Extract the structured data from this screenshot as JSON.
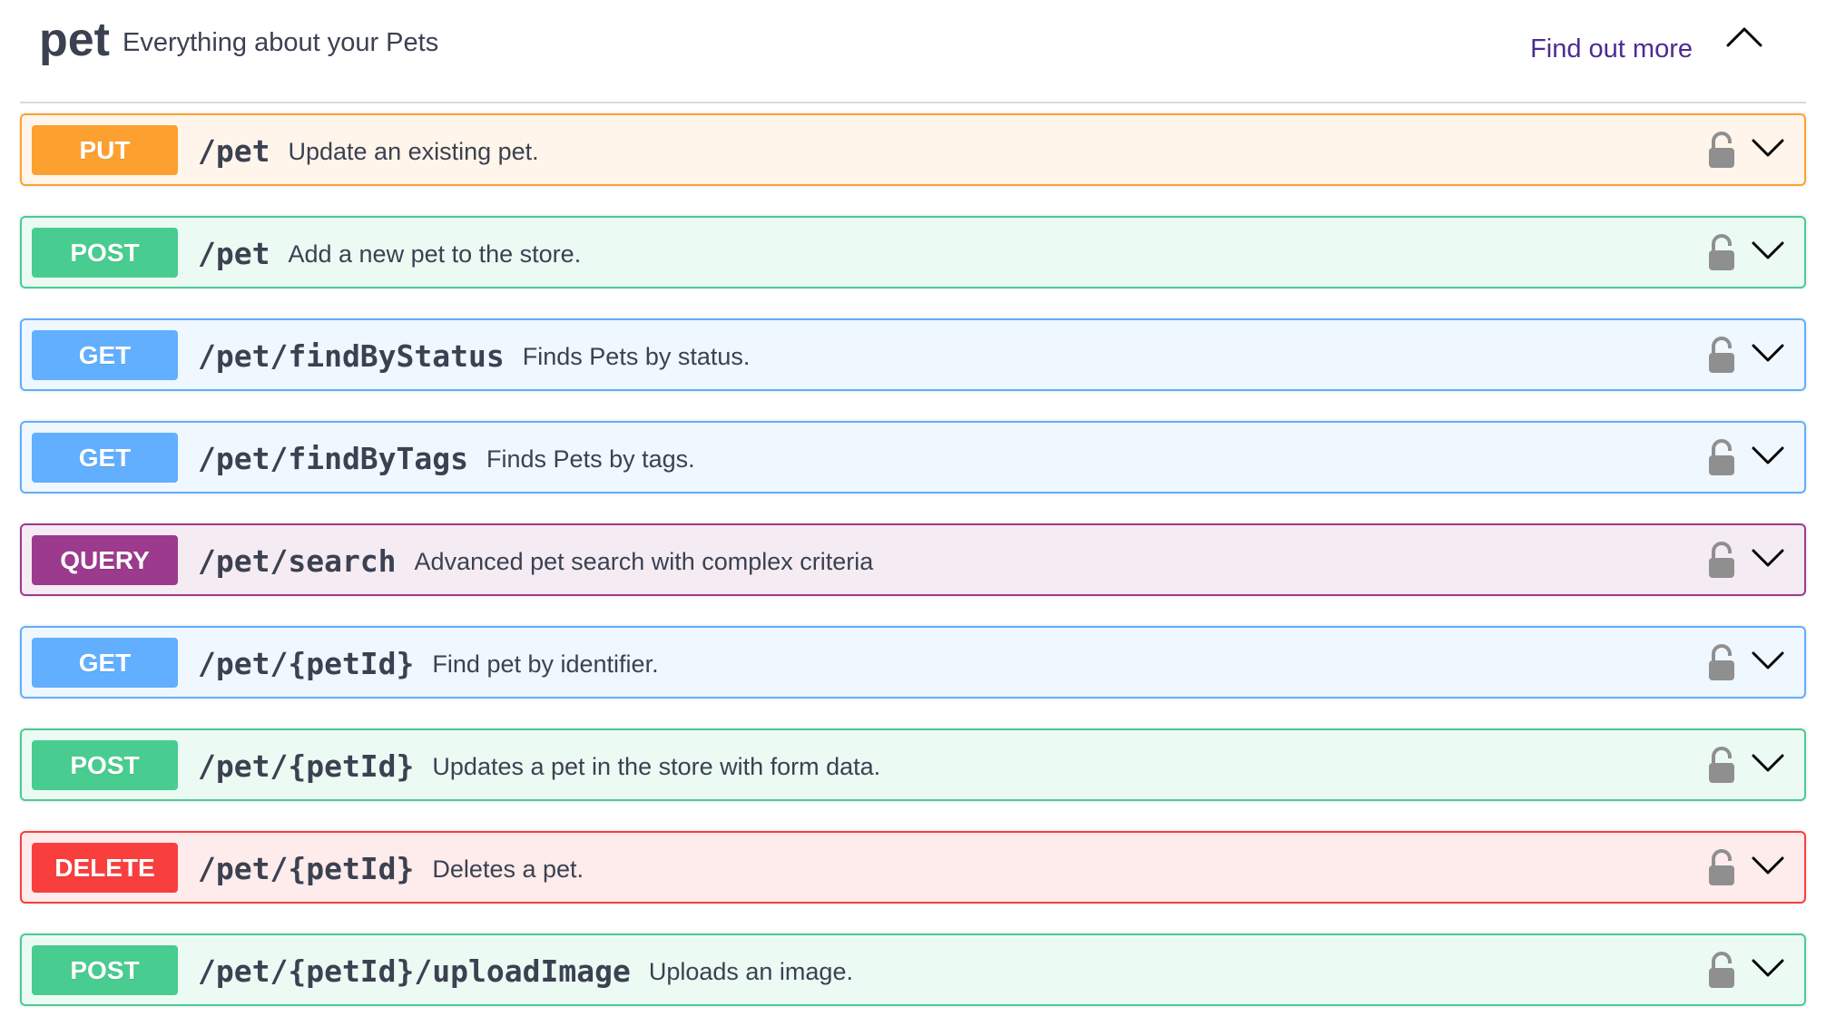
{
  "tag": {
    "name": "pet",
    "description": "Everything about your Pets",
    "link_label": "Find out more",
    "toggle_icon": "chevron-up-icon"
  },
  "colors": {
    "put": "#fca130",
    "post": "#49cc90",
    "get": "#61affe",
    "delete": "#f93e3e",
    "query": "#9c3a8e",
    "link": "#4c2c92",
    "text": "#3b4151"
  },
  "operations": [
    {
      "method": "PUT",
      "path": "/pet",
      "summary": "Update an existing pet.",
      "lock_icon": "lock-icon",
      "expand_icon": "chevron-down-icon"
    },
    {
      "method": "POST",
      "path": "/pet",
      "summary": "Add a new pet to the store.",
      "lock_icon": "lock-icon",
      "expand_icon": "chevron-down-icon"
    },
    {
      "method": "GET",
      "path": "/pet/findByStatus",
      "summary": "Finds Pets by status.",
      "lock_icon": "lock-icon",
      "expand_icon": "chevron-down-icon"
    },
    {
      "method": "GET",
      "path": "/pet/findByTags",
      "summary": "Finds Pets by tags.",
      "lock_icon": "lock-icon",
      "expand_icon": "chevron-down-icon"
    },
    {
      "method": "QUERY",
      "path": "/pet/search",
      "summary": "Advanced pet search with complex criteria",
      "lock_icon": "lock-icon",
      "expand_icon": "chevron-down-icon"
    },
    {
      "method": "GET",
      "path": "/pet/{petId}",
      "summary": "Find pet by identifier.",
      "lock_icon": "lock-icon",
      "expand_icon": "chevron-down-icon"
    },
    {
      "method": "POST",
      "path": "/pet/{petId}",
      "summary": "Updates a pet in the store with form data.",
      "lock_icon": "lock-icon",
      "expand_icon": "chevron-down-icon"
    },
    {
      "method": "DELETE",
      "path": "/pet/{petId}",
      "summary": "Deletes a pet.",
      "lock_icon": "lock-icon",
      "expand_icon": "chevron-down-icon"
    },
    {
      "method": "POST",
      "path": "/pet/{petId}/uploadImage",
      "summary": "Uploads an image.",
      "lock_icon": "lock-icon",
      "expand_icon": "chevron-down-icon"
    }
  ]
}
